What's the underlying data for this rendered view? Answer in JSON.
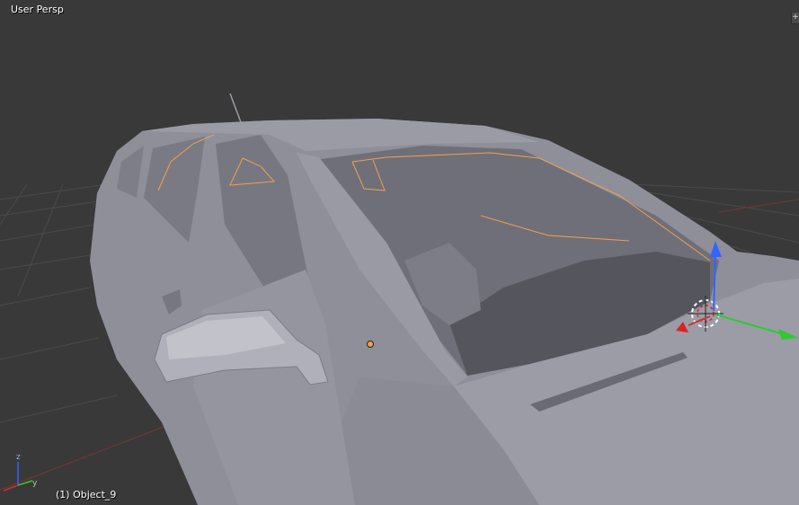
{
  "viewport": {
    "view_name": "User Persp",
    "object_info": "(1) Object_9",
    "corner_widget_icon": "plus-icon",
    "corner_widget_glyph": "+"
  },
  "axes_widget": {
    "z_label": "z",
    "y_label": "y",
    "x_color": "#c83232",
    "y_color": "#32c832",
    "z_color": "#3264ff"
  },
  "colors": {
    "background": "#393939",
    "grid": "#4b4b4b",
    "model": "#8e8e99",
    "selection_outline": "#f0a04b",
    "cursor": "#ffffff"
  }
}
